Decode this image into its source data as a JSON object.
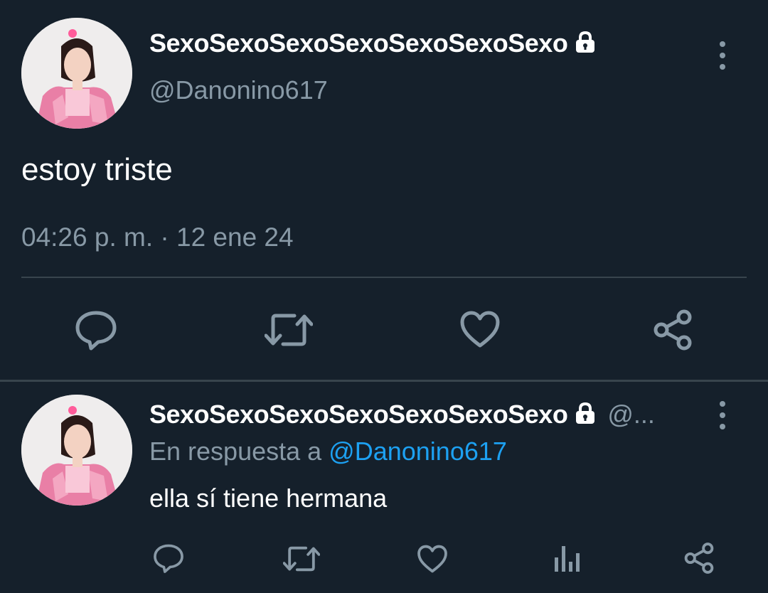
{
  "colors": {
    "background": "#15202b",
    "secondary_text": "#8899a6",
    "link": "#1da1f2",
    "divider": "#38444d"
  },
  "main_tweet": {
    "display_name": "SexoSexoSexoSexoSexoSexoSexo",
    "handle": "@Danonino617",
    "text": "estoy triste",
    "timestamp": "04:26 p. m. · 12 ene 24",
    "protected_icon": "lock-icon",
    "actions": [
      "reply-icon",
      "retweet-icon",
      "like-icon",
      "share-icon"
    ]
  },
  "reply_tweet": {
    "display_name": "SexoSexoSexoSexoSexoSexoSexo",
    "handle_truncated": "@...",
    "reply_prefix": "En respuesta a",
    "reply_mention": "@Danonino617",
    "text": "ella sí tiene hermana",
    "actions": [
      "reply-icon",
      "retweet-icon",
      "like-icon",
      "analytics-icon",
      "share-icon"
    ]
  }
}
